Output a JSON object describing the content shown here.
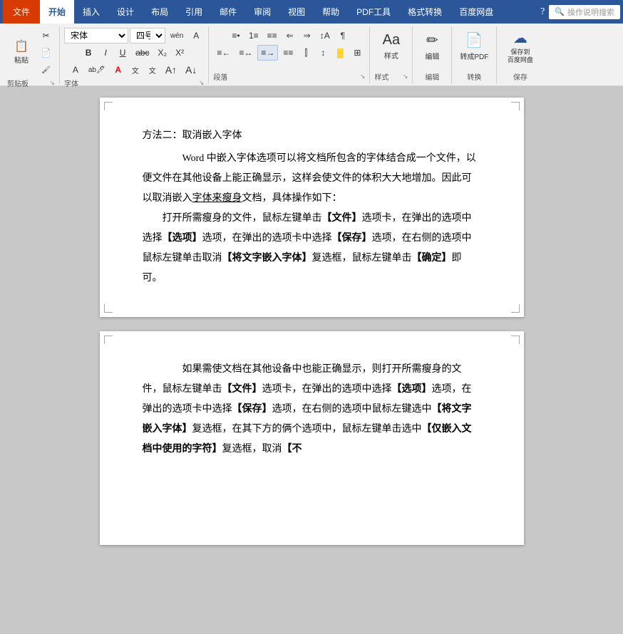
{
  "ribbon": {
    "tabs": [
      {
        "id": "file",
        "label": "文件",
        "type": "file"
      },
      {
        "id": "home",
        "label": "开始",
        "active": true
      },
      {
        "id": "insert",
        "label": "插入"
      },
      {
        "id": "design",
        "label": "设计"
      },
      {
        "id": "layout",
        "label": "布局"
      },
      {
        "id": "references",
        "label": "引用"
      },
      {
        "id": "mailings",
        "label": "邮件"
      },
      {
        "id": "review",
        "label": "审阅"
      },
      {
        "id": "view",
        "label": "视图"
      },
      {
        "id": "help",
        "label": "帮助"
      },
      {
        "id": "pdf",
        "label": "PDF工具"
      },
      {
        "id": "format",
        "label": "格式转换"
      },
      {
        "id": "baidu-cloud",
        "label": "百度网盘"
      }
    ],
    "search_placeholder": "操作说明搜索"
  },
  "toolbar": {
    "groups": {
      "clipboard": {
        "label": "剪贴板",
        "paste_label": "粘贴"
      },
      "font": {
        "label": "字体",
        "font_name": "宋体",
        "font_size": "四号",
        "font_width": "wén"
      },
      "paragraph": {
        "label": "段落"
      },
      "styles": {
        "label": "样式",
        "button_label": "样式"
      },
      "editing": {
        "label": "编辑",
        "button_label": "编辑"
      },
      "convert": {
        "label": "转换",
        "button_label": "转成PDF"
      },
      "save": {
        "label": "保存",
        "button_label": "保存到\n百度网盘"
      }
    }
  },
  "page1": {
    "heading": "方法二：取消嵌入字体",
    "paragraphs": [
      "　　Word 中嵌入字体选项可以将文档所包含的字体结合成一个文件，以便文件在其他设备上能正确显示，这样会使文件的体积大大地增加。因此可以取消嵌入字体来瘦身文档，具体操作如下：",
      "打开所需瘦身的文件，鼠标左键单击【文件】选项卡，在弹出的选项中选择【选项】选项，在弹出的选项卡中选择【保存】选项，在右侧的选项中鼠标左键单击取消【将文字嵌入字体】复选框，鼠标左键单击【确定】即可。"
    ],
    "underline_phrase": "字体来瘦身"
  },
  "page2": {
    "paragraphs": [
      "如果需使文档在其他设备中也能正确显示，则打开所需瘦身的文件，鼠标左键单击【文件】选项卡，在弹出的选项中选择【选项】选项，在弹出的选项卡中选择【保存】选项，在右侧的选项中鼠标左键选中【将文字嵌入字体】复选框，在其下方的俩个选项中，鼠标左键单击选中【仅嵌入文档中使用的字符】复选框，取消【不"
    ]
  }
}
